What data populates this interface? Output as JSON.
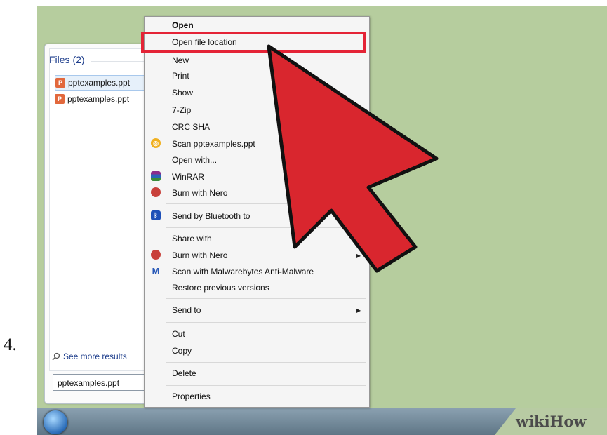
{
  "step_number": "4.",
  "start_panel": {
    "files_header": "Files (2)",
    "files": [
      "pptexamples.ppt",
      "pptexamples.ppt"
    ],
    "see_more": "See more results",
    "search_value": "pptexamples.ppt"
  },
  "context_menu": {
    "items": [
      {
        "label": "Open",
        "bold": true
      },
      {
        "label": "Open file location"
      },
      {
        "label": "New"
      },
      {
        "label": "Print"
      },
      {
        "label": "Show"
      },
      {
        "label": "7-Zip"
      },
      {
        "label": "CRC SHA"
      },
      {
        "label": "Scan pptexamples.ppt",
        "icon": "scan-icon"
      },
      {
        "label": "Open with..."
      },
      {
        "label": "WinRAR",
        "icon": "winrar-icon"
      },
      {
        "label": "Burn with Nero",
        "icon": "nero-icon"
      },
      {
        "label": "Send by Bluetooth to",
        "icon": "bluetooth-icon"
      },
      {
        "label": "Share with",
        "submenu": true
      },
      {
        "label": "Burn with Nero",
        "icon": "nero-icon",
        "submenu": true
      },
      {
        "label": "Scan with Malwarebytes Anti-Malware",
        "icon": "malwarebytes-icon"
      },
      {
        "label": "Restore previous versions"
      },
      {
        "label": "Send to",
        "submenu": true
      },
      {
        "label": "Cut"
      },
      {
        "label": "Copy"
      },
      {
        "label": "Delete"
      },
      {
        "label": "Properties"
      }
    ]
  },
  "watermark": "wikiHow",
  "colors": {
    "highlight": "#e42336",
    "arrow": "#d9262e",
    "desktop": "#b6cd9e"
  }
}
